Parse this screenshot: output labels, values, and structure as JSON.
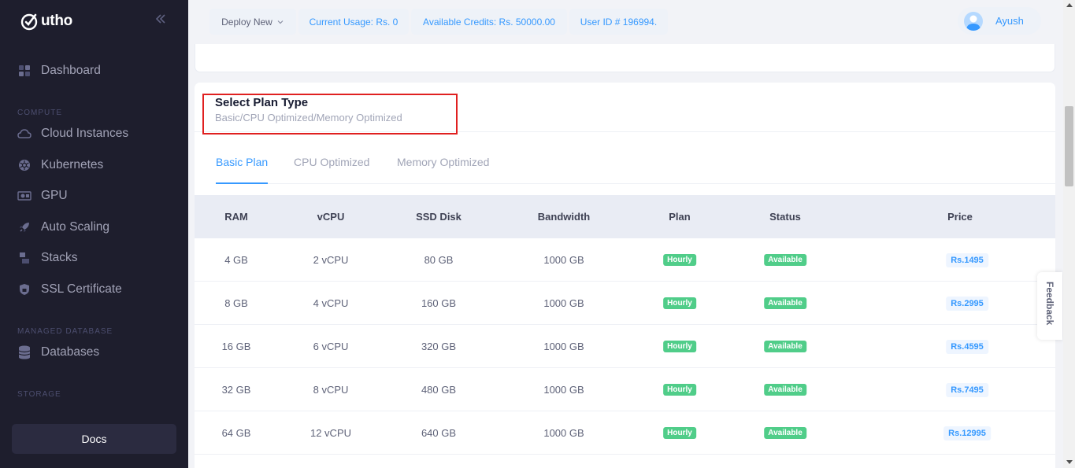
{
  "brand": {
    "name": "utho"
  },
  "sidebar": {
    "items": [
      {
        "label": "Dashboard",
        "icon": "dashboard-icon"
      },
      {
        "label": "Cloud Instances",
        "icon": "cloud-icon"
      },
      {
        "label": "Kubernetes",
        "icon": "kubernetes-icon"
      },
      {
        "label": "GPU",
        "icon": "gpu-icon"
      },
      {
        "label": "Auto Scaling",
        "icon": "rocket-icon"
      },
      {
        "label": "Stacks",
        "icon": "stacks-icon"
      },
      {
        "label": "SSL Certificate",
        "icon": "ssl-icon"
      },
      {
        "label": "Databases",
        "icon": "database-icon"
      }
    ],
    "sections": {
      "compute": "COMPUTE",
      "managed_database": "MANAGED DATABASE",
      "storage": "STORAGE"
    },
    "docs_label": "Docs"
  },
  "topbar": {
    "deploy": "Deploy New",
    "usage": "Current Usage: Rs. 0",
    "credits": "Available Credits: Rs. 50000.00",
    "user_id": "User ID # 196994.",
    "user_name": "Ayush"
  },
  "plan": {
    "title": "Select Plan Type",
    "subtitle": "Basic/CPU Optimized/Memory Optimized",
    "tabs": [
      "Basic Plan",
      "CPU Optimized",
      "Memory Optimized"
    ],
    "active_tab": "Basic Plan"
  },
  "table": {
    "headers": [
      "RAM",
      "vCPU",
      "SSD Disk",
      "Bandwidth",
      "Plan",
      "Status",
      "Price"
    ],
    "rows": [
      {
        "ram": "4 GB",
        "vcpu": "2 vCPU",
        "ssd": "80 GB",
        "bandwidth": "1000 GB",
        "plan": "Hourly",
        "status": "Available",
        "price": "Rs.1495"
      },
      {
        "ram": "8 GB",
        "vcpu": "4 vCPU",
        "ssd": "160 GB",
        "bandwidth": "1000 GB",
        "plan": "Hourly",
        "status": "Available",
        "price": "Rs.2995"
      },
      {
        "ram": "16 GB",
        "vcpu": "6 vCPU",
        "ssd": "320 GB",
        "bandwidth": "1000 GB",
        "plan": "Hourly",
        "status": "Available",
        "price": "Rs.4595"
      },
      {
        "ram": "32 GB",
        "vcpu": "8 vCPU",
        "ssd": "480 GB",
        "bandwidth": "1000 GB",
        "plan": "Hourly",
        "status": "Available",
        "price": "Rs.7495"
      },
      {
        "ram": "64 GB",
        "vcpu": "12 vCPU",
        "ssd": "640 GB",
        "bandwidth": "1000 GB",
        "plan": "Hourly",
        "status": "Available",
        "price": "Rs.12995"
      }
    ]
  },
  "feedback_label": "Feedback",
  "colors": {
    "sidebar_bg": "#1e1e2d",
    "accent": "#3699ff",
    "success": "#50cd89",
    "highlight_border": "#e02020"
  }
}
